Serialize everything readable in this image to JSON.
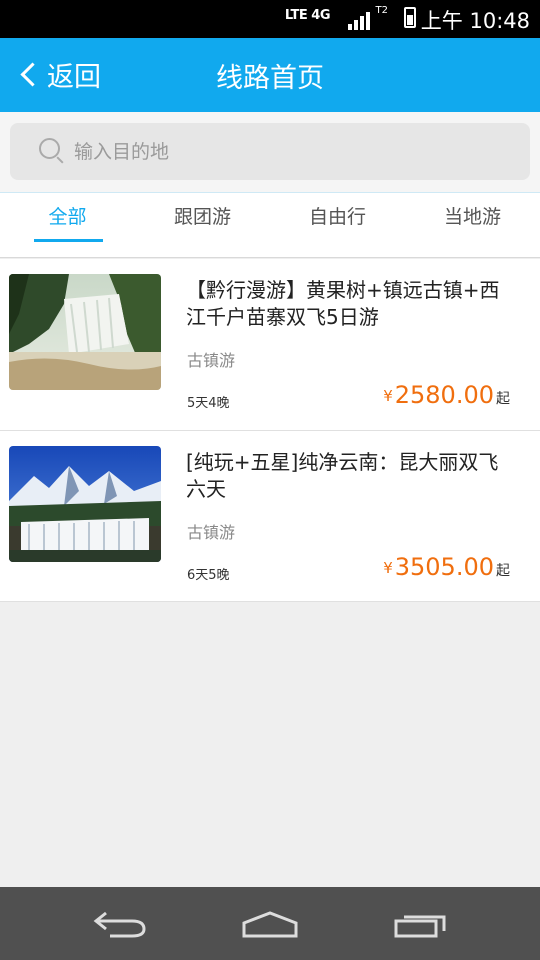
{
  "status_bar": {
    "network": "LTE 4G",
    "sim": "T2",
    "time": "上午 10:48"
  },
  "header": {
    "back_label": "返回",
    "title": "线路首页"
  },
  "search": {
    "placeholder": "输入目的地",
    "value": ""
  },
  "tabs": [
    {
      "label": "全部",
      "active": true
    },
    {
      "label": "跟团游",
      "active": false
    },
    {
      "label": "自由行",
      "active": false
    },
    {
      "label": "当地游",
      "active": false
    }
  ],
  "routes": [
    {
      "name": "【黔行漫游】黄果树+镇远古镇+西江千户苗寨双飞5日游",
      "tag": "古镇游",
      "duration": "5天4晚",
      "currency": "¥",
      "price": "2580.00",
      "price_suffix": "起",
      "image": "waterfall-photo"
    },
    {
      "name": "[纯玩+五星]纯净云南：昆大丽双飞六天",
      "tag": "古镇游",
      "duration": "6天5晚",
      "currency": "¥",
      "price": "3505.00",
      "price_suffix": "起",
      "image": "snow-mountain-waterfall-photo"
    }
  ],
  "colors": {
    "accent": "#11a9ee",
    "price": "#f06e0e",
    "navbar": "#505050"
  }
}
